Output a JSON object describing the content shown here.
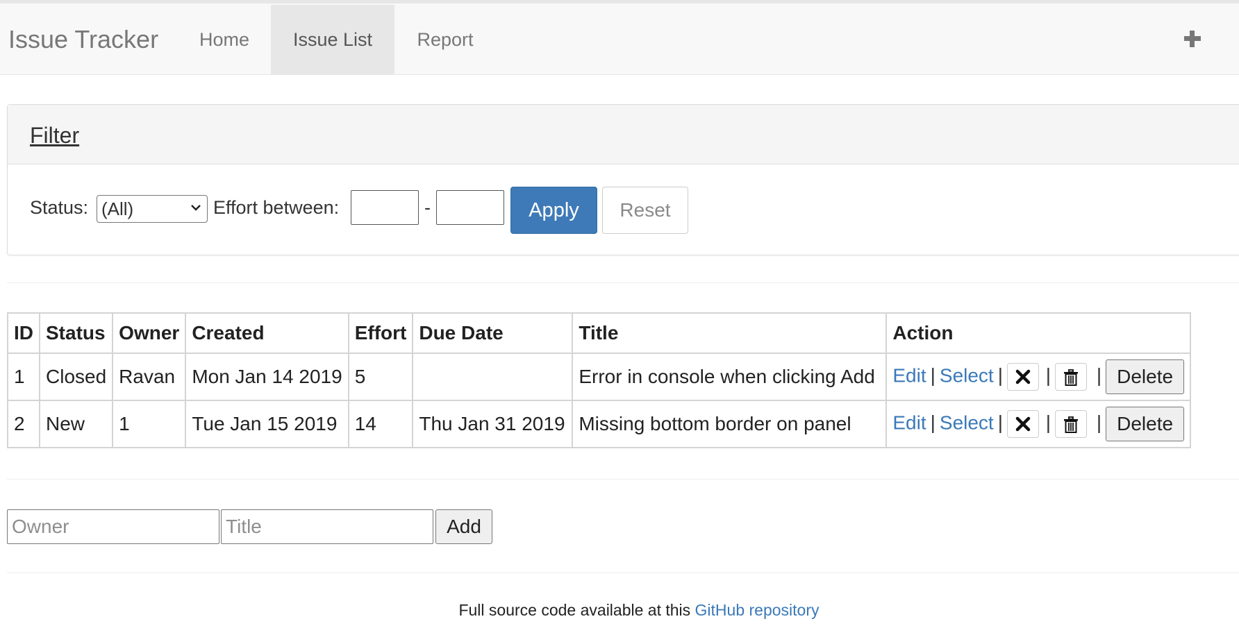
{
  "navbar": {
    "brand": "Issue Tracker",
    "items": [
      {
        "label": "Home",
        "active": false
      },
      {
        "label": "Issue List",
        "active": true
      },
      {
        "label": "Report",
        "active": false
      }
    ],
    "add_icon": "plus-icon"
  },
  "filter": {
    "title": "Filter",
    "status_label": "Status:",
    "status_value": "(All)",
    "effort_label": "Effort between:",
    "effort_separator": "-",
    "effort_min": "",
    "effort_max": "",
    "apply_label": "Apply",
    "reset_label": "Reset"
  },
  "table": {
    "headers": [
      "ID",
      "Status",
      "Owner",
      "Created",
      "Effort",
      "Due Date",
      "Title",
      "Action"
    ],
    "rows": [
      {
        "id": "1",
        "status": "Closed",
        "owner": "Ravan",
        "created": "Mon Jan 14 2019",
        "effort": "5",
        "due": "",
        "title": "Error in console when clicking Add"
      },
      {
        "id": "2",
        "status": "New",
        "owner": "1",
        "created": "Tue Jan 15 2019",
        "effort": "14",
        "due": "Thu Jan 31 2019",
        "title": "Missing bottom border on panel"
      }
    ],
    "actions": {
      "edit": "Edit",
      "select": "Select",
      "separator": "|",
      "close_icon": "close-icon",
      "trash_icon": "trash-icon",
      "delete": "Delete"
    }
  },
  "add_form": {
    "owner_placeholder": "Owner",
    "title_placeholder": "Title",
    "add_label": "Add"
  },
  "footer": {
    "text": "Full source code available at this",
    "link": "GitHub repository"
  },
  "colors": {
    "link": "#3a79b8",
    "primary_button": "#3e7ab8",
    "navbar_bg": "#f8f8f8"
  }
}
